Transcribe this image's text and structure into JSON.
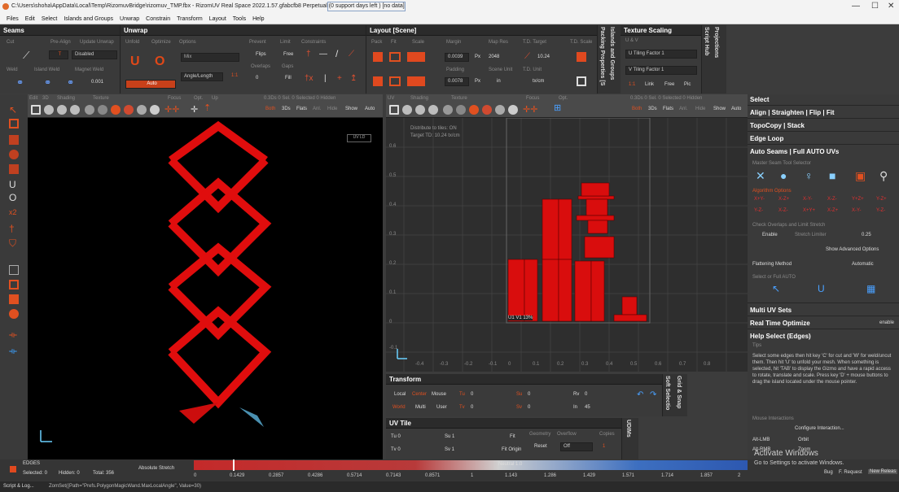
{
  "window": {
    "title": "C:\\Users\\shoha\\AppData\\Local\\Temp\\RizomuvBridge\\rizomuv_TMP.fbx - RizomUV  Real Space 2022.1.57.gfabcfb8 Perpetual  (0 support days left ) [no data]",
    "minimize": "—",
    "close": "✕"
  },
  "menu": [
    "Files",
    "Edit",
    "Select",
    "Islands and Groups",
    "Unwrap",
    "Constrain",
    "Transform",
    "Layout",
    "Tools",
    "Help"
  ],
  "seams": {
    "title": "Seams",
    "labels": {
      "cut": "Cut",
      "prealign": "Pre-Align",
      "update": "Update Unwrap",
      "weld": "Weld",
      "island_weld": "Island Weld",
      "magnet_weld": "Magnet Weld"
    },
    "disabled": "Disabled",
    "t_value": "T",
    "magnet_value": "0.001"
  },
  "unwrap": {
    "title": "Unwrap",
    "labels": {
      "unfold": "Unfold",
      "optimize": "Optimize",
      "options": "Options",
      "prevent": "Prevent",
      "limit": "Limit",
      "constraints": "Constraints",
      "flips": "Flips",
      "free": "Free",
      "overlaps": "Overlaps",
      "gaps": "Gaps",
      "fill": "Fill"
    },
    "mix": "Mix",
    "angle_length": "Angle/Length",
    "ratio": "1:1",
    "auto": "Auto",
    "zero": "0"
  },
  "layout": {
    "title": "Layout [Scene]",
    "labels": {
      "pack": "Pack",
      "fit": "Fit",
      "scale": "Scale",
      "margin": "Margin",
      "map_res": "Map Res",
      "td_target": "T.D. Target",
      "td_scale": "T.D. Scale",
      "padding": "Padding",
      "scene_unit": "Scene Unit",
      "td_unit": "T.D. Unit"
    },
    "margin": "0.0039",
    "px1": "Px",
    "map_res_value": "2048",
    "td_value": "10.24",
    "padding": "0.0078",
    "px2": "Px",
    "scene_unit_value": "in",
    "td_unit_value": "tx/cm"
  },
  "side_tabs": {
    "packing": "Packing Properties [S",
    "islands": "Islands and Groups",
    "script": "Script Hub",
    "projections": "Projections"
  },
  "texture_scaling": {
    "title": "Texture Scaling",
    "uv": "U & V",
    "u_tiling": "U Tiling Factor",
    "u_value": "1",
    "v_tiling": "V Tiling Factor",
    "v_value": "1",
    "ratio": "1:1",
    "link": "Link",
    "free": "Free",
    "pic": "Pic"
  },
  "viewport3d": {
    "labels": {
      "edit": "Edit",
      "d3": "3D",
      "shading": "Shading",
      "texture": "Texture",
      "focus": "Focus",
      "opt": "Opt.",
      "up": "Up"
    },
    "info": "0.3Ds 0 Sel.  0 Selected  0 Hidden",
    "both": "Both",
    "ds": "3Ds",
    "flats": "Flats",
    "anl": "Anl.",
    "hide": "Hide",
    "show": "Show",
    "auto": "Auto",
    "corner": "UV  LD"
  },
  "viewportuv": {
    "labels": {
      "uv": "UV",
      "shading": "Shading",
      "texture": "Texture",
      "focus": "Focus",
      "opt": "Opt."
    },
    "info": "0.3Ds 0 Sel.  0 Selected  0 Hidden",
    "both": "Both",
    "ds": "3Ds",
    "flats": "Flats",
    "anl": "Anl.",
    "hide": "Hide",
    "show": "Show",
    "auto": "Auto",
    "distribute": "Distribute to tiles: ON",
    "target": "Target TD: 10.24 tx/cm",
    "tile_label": "U1 V1   13%",
    "y_ticks": [
      "0.6",
      "0.5",
      "0.4",
      "0.3",
      "0.2",
      "0.1",
      "0",
      "-0.1"
    ],
    "x_ticks": [
      "-0.4",
      "-0.3",
      "-0.2",
      "-0.1",
      "0",
      "0.1",
      "0.2",
      "0.3",
      "0.4",
      "0.5",
      "0.6",
      "0.7",
      "0.8"
    ]
  },
  "transform": {
    "title": "Transform",
    "local": "Local",
    "center": "Center",
    "mouse": "Mouse",
    "world": "World",
    "multi": "Multi",
    "user": "User",
    "tu": "Tu",
    "tu_val": "0",
    "tv": "Tv",
    "tv_val": "0",
    "su": "Su",
    "su_val": "0",
    "sv": "Sv",
    "sv_val": "0",
    "rv": "Rv",
    "rv_val": "0",
    "in": "In",
    "in_val": "45",
    "grid": "Grid & Snap",
    "soft": "Soft Selectio"
  },
  "uvtile": {
    "title": "UV Tile",
    "tu": "Tu 0",
    "tv": "Tv 0",
    "su": "Su 1",
    "sv": "Sv 1",
    "fit": "Fit",
    "fit_origin": "Fit Origin",
    "geometry": "Geometry",
    "overflow": "Overflow",
    "reset": "Reset",
    "off": "Off",
    "copies": "Copies",
    "copies_val": "1",
    "udims": "UDIMs"
  },
  "right": {
    "select": "Select",
    "align": "Align | Straighten | Flip | Fit",
    "topocopy": "TopoCopy | Stack",
    "edge_loop": "Edge Loop",
    "auto_seams": "Auto Seams | Full AUTO UVs",
    "master_seam": "Master Seam Tool Selector",
    "algo": "Algorithm Options",
    "axes_row1": [
      "X+Y-",
      "X-Z+",
      "X-Y-",
      "X-Z-",
      "Y+Z+",
      "Y-Z+"
    ],
    "axes_row2": [
      "Y-Z-",
      "X-Z-",
      "X+Y+",
      "X-Z+",
      "X-Y-",
      "Y-Z-"
    ],
    "check_overlaps": "Check Overlaps and Limit Stretch",
    "enable": "Enable",
    "stretch_limiter": "Stretch Limiter",
    "stretch_val": "0.25",
    "show_adv": "Show Advanced Options",
    "flattening": "Flattening Method",
    "automatic": "Automatic",
    "select_full": "Select or Full AUTO",
    "multi_uv": "Multi UV Sets",
    "rto": "Real Time Optimize",
    "rto_val": "enable",
    "help_select": "Help Select (Edges)",
    "tips": "Tips",
    "tips_text": "Select some edges then hit key 'C' for cut and 'W' for weld/uncut them. Then hit 'U' to unfold your mesh. When something is selected, hit 'TAB' to display the Gizmo and have a rapid access to rotate, translate and scale. Press key 'D' + mouse buttons to drag the island located under the mouse pointer.",
    "mouse_interactions": "Mouse Interactions",
    "configure": "Configure Interaction...",
    "alt_lmb": "Alt-LMB",
    "orbit": "Orbit",
    "alt_rmb": "Alt-RMB",
    "zoom": "Zoom"
  },
  "status": {
    "mode": "EDGES",
    "selected": "Selected: 0",
    "hidden": "Hidden: 0",
    "total": "Total: 356",
    "abs": "Absolute Stretch",
    "neutral": "Neutral 1.0",
    "ticks": [
      "0",
      "0.1429",
      "0.2857",
      "0.4286",
      "0.5714",
      "0.7143",
      "0.8571",
      "1",
      "1.143",
      "1.286",
      "1.429",
      "1.571",
      "1.714",
      "1.857",
      "2"
    ],
    "activate1": "Activate Windows",
    "activate2": "Go to Settings to activate Windows.",
    "bug": "Bug",
    "request": "F. Request",
    "new": "New Releas"
  },
  "bottom": {
    "script_log": "Script & Log...",
    "cmd": "ZomSet({Path=\"Prefs.PolygonMagicWand.MaxLocalAngle\", Value=30)"
  }
}
